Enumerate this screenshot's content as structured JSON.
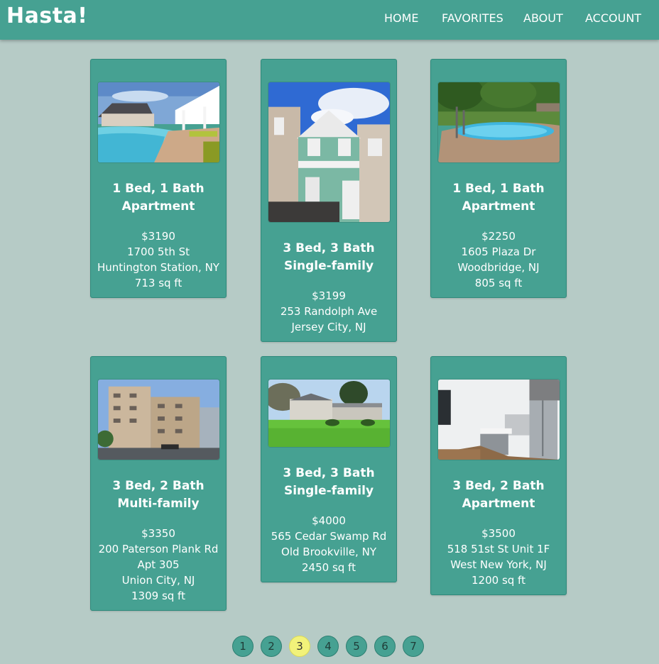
{
  "app": {
    "brand": "Hasta!",
    "nav": [
      "HOME",
      "FAVORITES",
      "ABOUT",
      "ACCOUNT"
    ]
  },
  "listings": [
    {
      "title": "1 Bed, 1 Bath Apartment",
      "title_lines": [
        "1 Bed, 1 Bath",
        "Apartment"
      ],
      "price": "$3190",
      "address_lines": [
        "1700 5th St",
        "Huntington Station, NY"
      ],
      "sqft": "713 sq ft",
      "image": "resort-pool-photo"
    },
    {
      "title": "3 Bed, 3 Bath Single-family",
      "title_lines": [
        "3 Bed, 3 Bath",
        "Single-family"
      ],
      "price": "$3199",
      "address_lines": [
        "253 Randolph Ave",
        "Jersey City, NJ"
      ],
      "sqft": "",
      "image": "townhouse-photo"
    },
    {
      "title": "1 Bed, 1 Bath Apartment",
      "title_lines": [
        "1 Bed, 1 Bath",
        "Apartment"
      ],
      "price": "$2250",
      "address_lines": [
        "1605 Plaza Dr",
        "Woodbridge, NJ"
      ],
      "sqft": "805 sq ft",
      "image": "backyard-pool-photo"
    },
    {
      "title": "3 Bed, 2 Bath Multi-family",
      "title_lines": [
        "3 Bed, 2 Bath",
        "Multi-family"
      ],
      "price": "$3350",
      "address_lines": [
        "200 Paterson Plank Rd",
        "Apt 305",
        "Union City, NJ"
      ],
      "sqft": "1309 sq ft",
      "image": "apartment-building-photo"
    },
    {
      "title": "3 Bed, 3 Bath Single-family",
      "title_lines": [
        "3 Bed, 3 Bath",
        "Single-family"
      ],
      "price": "$4000",
      "address_lines": [
        "565 Cedar Swamp Rd",
        "Old Brookville, NY"
      ],
      "sqft": "2450 sq ft",
      "image": "house-lawn-photo"
    },
    {
      "title": "3 Bed, 2 Bath Apartment",
      "title_lines": [
        "3 Bed, 2 Bath",
        "Apartment"
      ],
      "price": "$3500",
      "address_lines": [
        "518 51st St Unit 1F",
        "West New York, NJ"
      ],
      "sqft": "1200 sq ft",
      "image": "kitchen-photo"
    }
  ],
  "pagination": {
    "pages": [
      "1",
      "2",
      "3",
      "4",
      "5",
      "6",
      "7"
    ],
    "current": "3"
  },
  "colors": {
    "background": "#b6cbc6",
    "primary": "#46a192",
    "active_page": "#f2f27a"
  }
}
